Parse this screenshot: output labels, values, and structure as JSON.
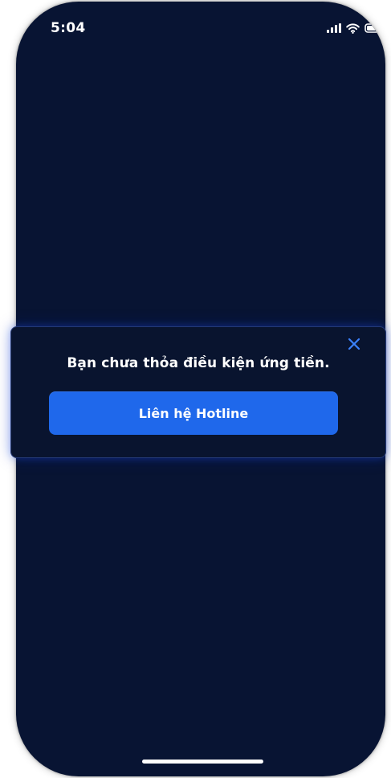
{
  "status_bar": {
    "time": "5:04",
    "icons": [
      "signal-icon",
      "wifi-icon",
      "battery-icon"
    ]
  },
  "dialog": {
    "message": "Bạn chưa thỏa điều kiện ứng tiền.",
    "button_label": "Liên hệ Hotline",
    "close_icon": "close-icon"
  },
  "colors": {
    "background": "#081433",
    "dialog_background": "#09142f",
    "accent": "#1f68eb",
    "close_icon": "#3b82ff",
    "text": "#ffffff"
  }
}
